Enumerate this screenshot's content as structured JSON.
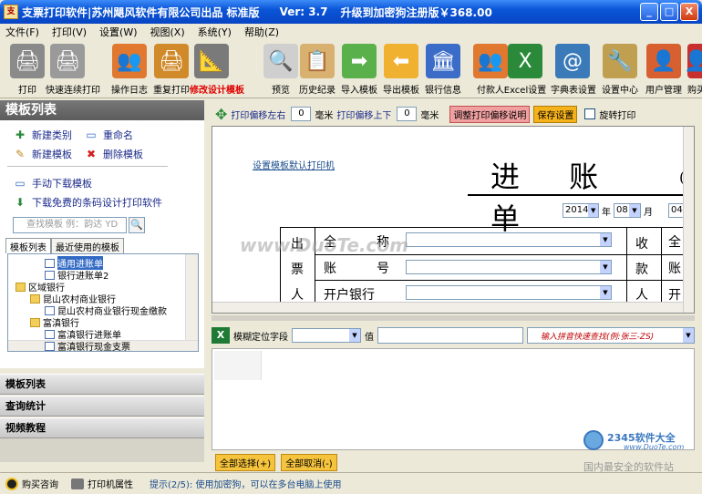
{
  "window": {
    "title": "支票打印软件|苏州飓风软件有限公司出品 标准版",
    "version": "Ver: 3.7",
    "upgrade": "升级到加密狗注册版￥368.00",
    "min_label": "_",
    "max_label": "□",
    "close_label": "X"
  },
  "menu": [
    "文件(F)",
    "打印(V)",
    "设置(W)",
    "视图(X)",
    "系统(Y)",
    "帮助(Z)"
  ],
  "toolbar": [
    {
      "label": "打印",
      "icon": "printer-icon",
      "color": "#8a8a8a",
      "glyph": "🖨"
    },
    {
      "label": "快速连续打印",
      "icon": "batch-print-icon",
      "color": "#9a9a9a",
      "glyph": "🖨"
    },
    {
      "label": "操作日志",
      "icon": "users-log-icon",
      "color": "#e07830",
      "glyph": "👥"
    },
    {
      "label": "重复打印",
      "icon": "reprint-icon",
      "color": "#d08a2a",
      "glyph": "🖨"
    },
    {
      "label": "修改设计模板",
      "icon": "design-tools-icon",
      "color": "#7a7a7a",
      "glyph": "📐",
      "red": true
    },
    {
      "label": "预览",
      "icon": "magnifier-icon",
      "color": "#cfcfcf",
      "glyph": "🔍"
    },
    {
      "label": "历史纪录",
      "icon": "clipboard-icon",
      "color": "#d8b070",
      "glyph": "📋"
    },
    {
      "label": "导入模板",
      "icon": "arrow-right-icon",
      "color": "#5ab04a",
      "glyph": "➡"
    },
    {
      "label": "导出模板",
      "icon": "arrow-left-icon",
      "color": "#f0b030",
      "glyph": "⬅"
    },
    {
      "label": "银行信息",
      "icon": "bank-icon",
      "color": "#3a6cc8",
      "glyph": "🏛"
    },
    {
      "label": "付款人",
      "icon": "payer-icon",
      "color": "#e07830",
      "glyph": "👥"
    },
    {
      "label": "Excel设置",
      "icon": "excel-icon",
      "color": "#2a8a3a",
      "glyph": "X"
    },
    {
      "label": "字典表设置",
      "icon": "dictionary-icon",
      "color": "#3a7ab8",
      "glyph": "@"
    },
    {
      "label": "设置中心",
      "icon": "settings-tools-icon",
      "color": "#c0a050",
      "glyph": "🔧"
    },
    {
      "label": "用户管理",
      "icon": "user-admin-icon",
      "color": "#d86030",
      "glyph": "👤"
    },
    {
      "label": "购买",
      "icon": "buy-icon",
      "color": "#c83030",
      "glyph": "👤"
    }
  ],
  "left_panel": {
    "header": "模板列表",
    "actions": [
      {
        "label": "新建类别",
        "icon": "new-category-icon",
        "glyph": "✚"
      },
      {
        "label": "重命名",
        "icon": "rename-icon",
        "glyph": "▭"
      },
      {
        "label": "新建模板",
        "icon": "new-template-icon",
        "glyph": "✎"
      },
      {
        "label": "删除模板",
        "icon": "delete-icon",
        "glyph": "✖"
      },
      {
        "label": "手动下载模板",
        "icon": "download-icon",
        "glyph": "▭"
      },
      {
        "label": "下载免费的条码设计打印软件",
        "icon": "download-arrow-icon",
        "glyph": "⬇"
      }
    ],
    "search_placeholder": "查找模板 例：韵达 YD",
    "tabs": [
      "模板列表",
      "最近使用的模板"
    ],
    "tree": [
      {
        "label": "通用进账单",
        "type": "doc",
        "level": 2,
        "selected": true
      },
      {
        "label": "银行进账单2",
        "type": "doc",
        "level": 2
      },
      {
        "label": "区域银行",
        "type": "folder",
        "level": 0
      },
      {
        "label": "昆山农村商业银行",
        "type": "folder",
        "level": 1
      },
      {
        "label": "昆山农村商业银行现金缴款",
        "type": "doc",
        "level": 2
      },
      {
        "label": "富滇银行",
        "type": "folder",
        "level": 1
      },
      {
        "label": "富滇银行进账单",
        "type": "doc",
        "level": 2
      },
      {
        "label": "富滇银行现金支票",
        "type": "doc",
        "level": 2
      }
    ],
    "nav": [
      "模板列表",
      "查询统计",
      "视频教程"
    ]
  },
  "offset_bar": {
    "left_label": "打印偏移左右",
    "left_value": "0",
    "unit1": "毫米",
    "up_label": "打印偏移上下",
    "up_value": "0",
    "unit2": "毫米",
    "explain_button": "调整打印偏移说明",
    "save_button": "保存设置",
    "rotate_label": "旋转打印"
  },
  "design": {
    "link": "设置模板默认打印机",
    "title": "进 账 单",
    "title_paren": "(",
    "year": "2014",
    "year_label": "年",
    "month": "08",
    "month_label": "月",
    "day": "04",
    "left_vertical": [
      "出",
      "票",
      "人"
    ],
    "right_vertical": [
      "收",
      "款",
      "人"
    ],
    "rows": [
      {
        "l1": "全",
        "l2": "称"
      },
      {
        "l1": "账",
        "l2": "号"
      },
      {
        "l1": "开户银行",
        "l2": ""
      }
    ],
    "right_rows": [
      "全",
      "账",
      "开"
    ],
    "watermark": "www.DuoTe.com"
  },
  "query": {
    "field_label": "模糊定位字段",
    "value_label": "值",
    "pinyin_hint": "输入拼音快速查找(例:张三-ZS)"
  },
  "bottom_buttons": {
    "select_all": "全部选择(+)",
    "cancel_all": "全部取消(-)"
  },
  "statusbar": {
    "buy_consult": "购买咨询",
    "printer_props": "打印机属性",
    "hint": "提示(2/5): 使用加密狗，可以在多台电脑上使用"
  },
  "brand": {
    "logo_text": "2345软件大全",
    "logo_url": "www.DuoTe.com",
    "slogan": "国内最安全的软件站"
  }
}
